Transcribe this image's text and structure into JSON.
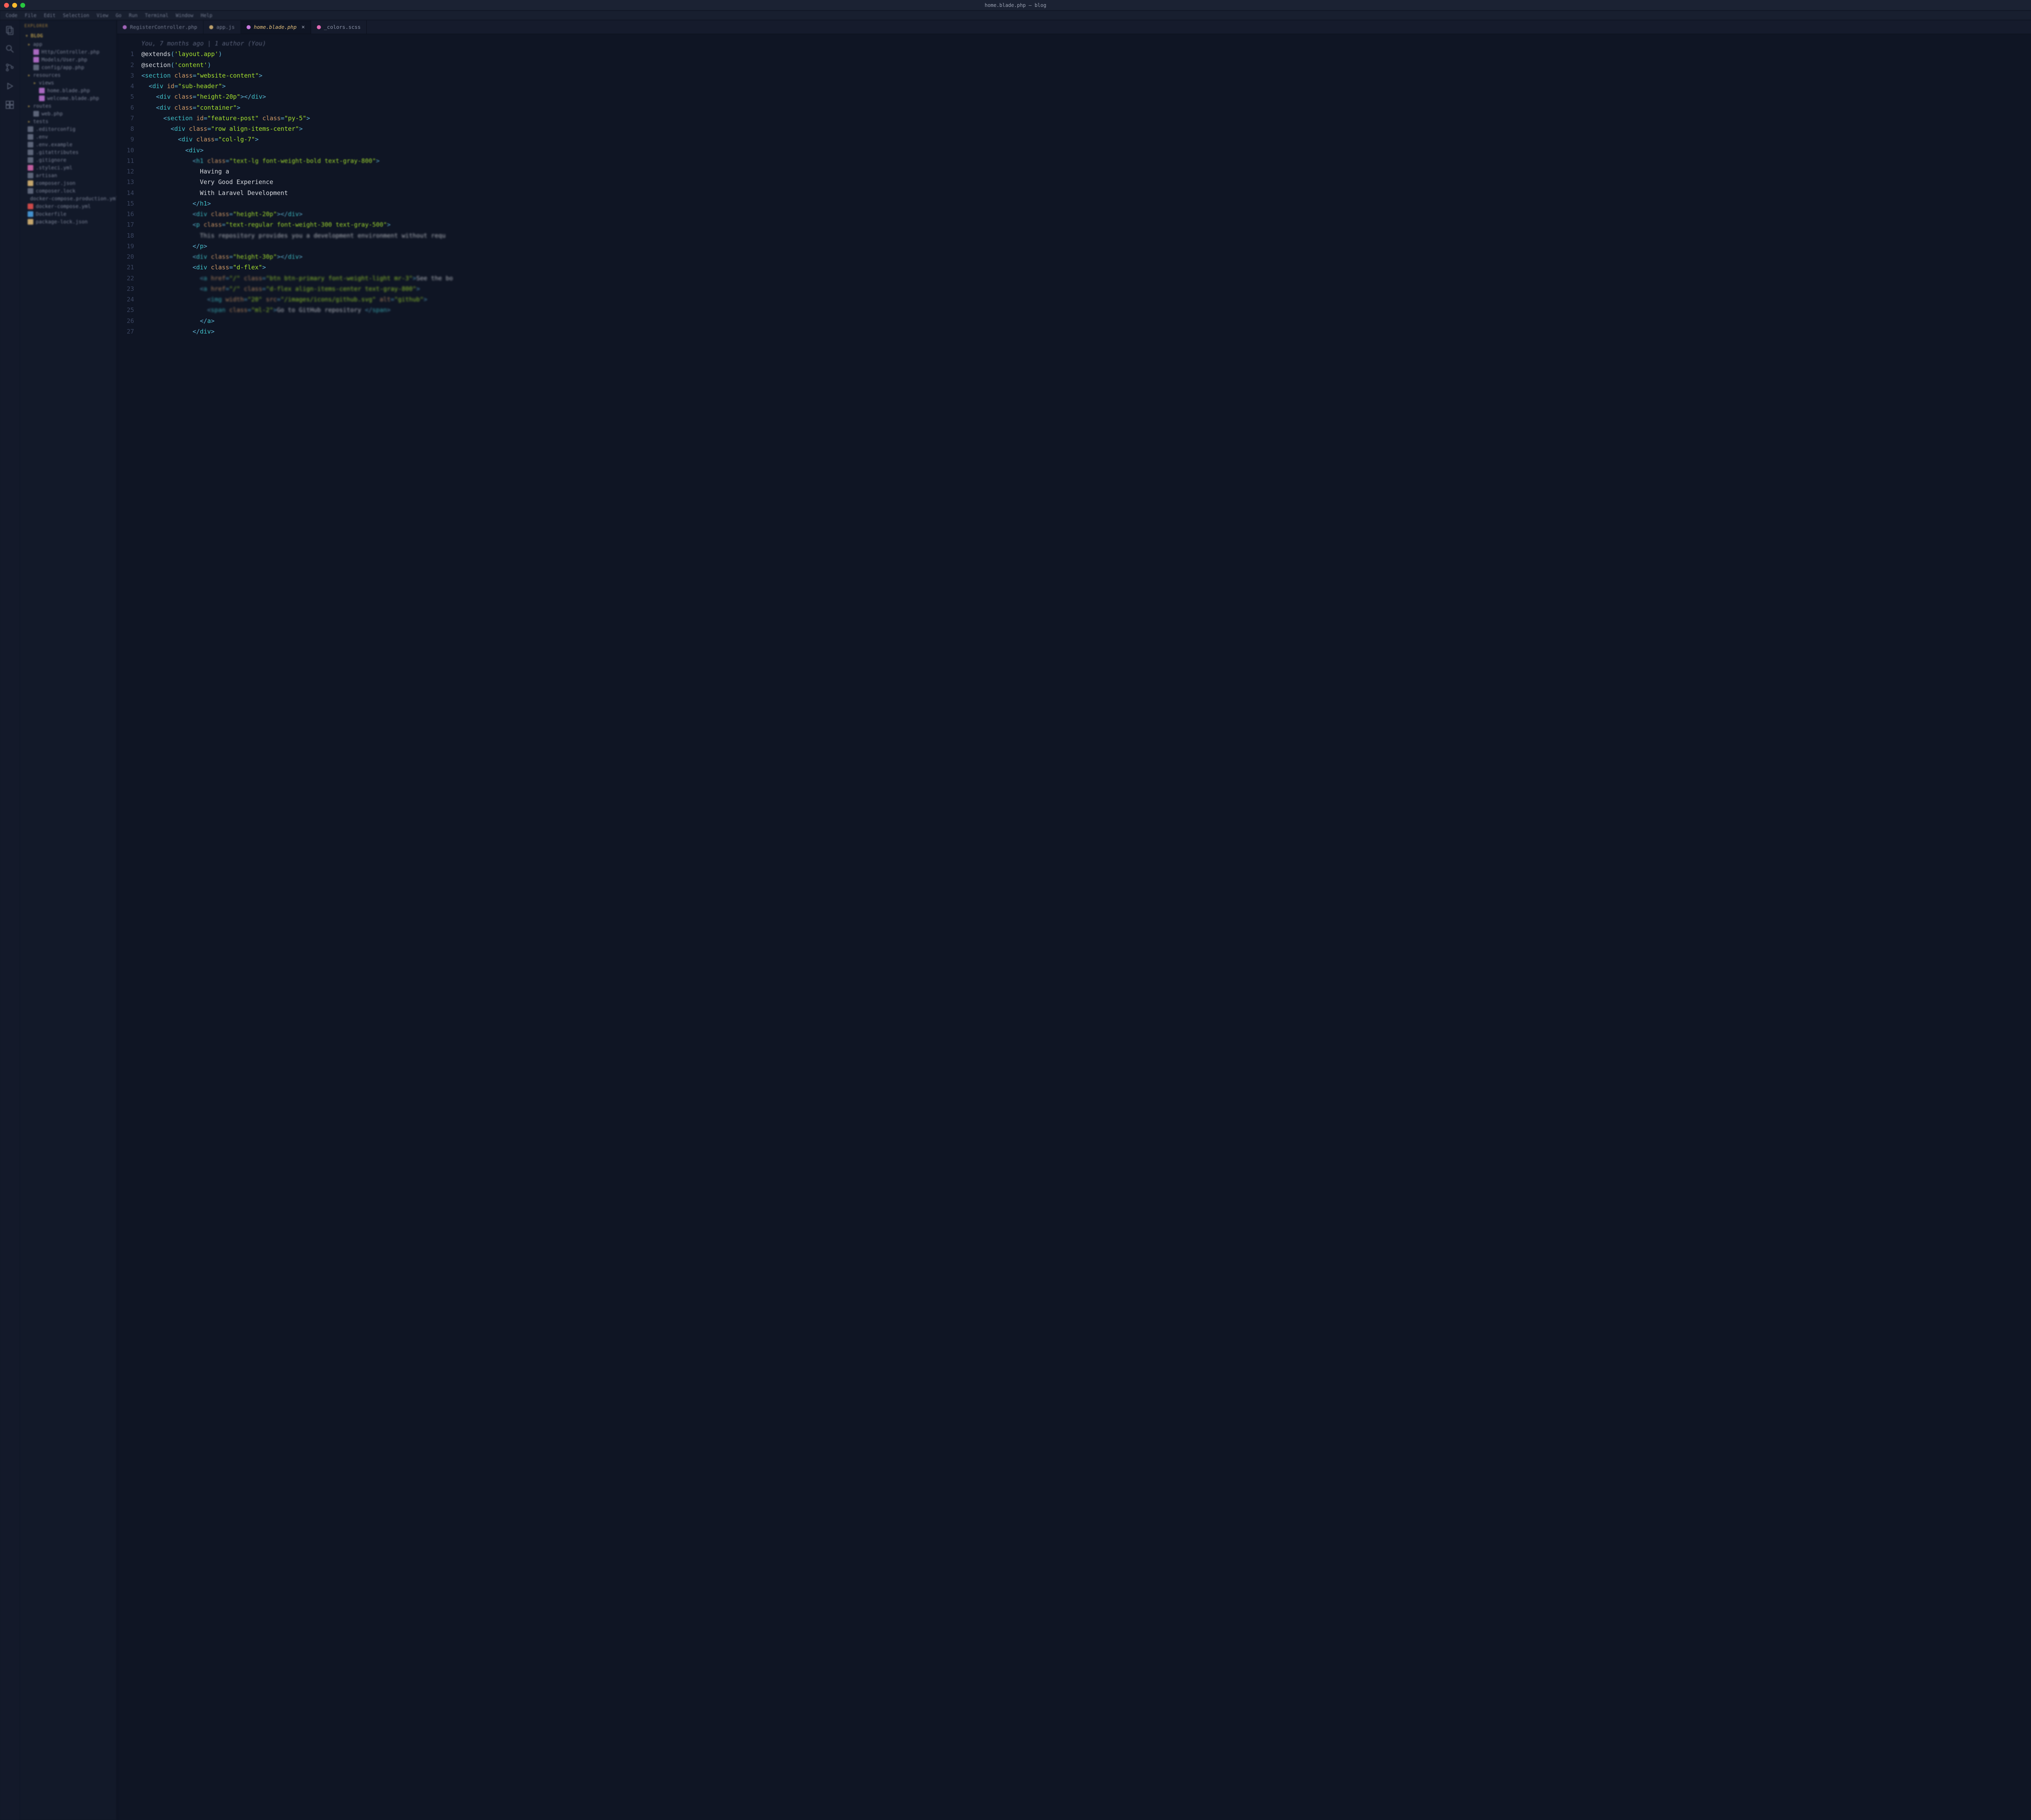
{
  "window": {
    "title": "home.blade.php — blog"
  },
  "menu": [
    "Code",
    "File",
    "Edit",
    "Selection",
    "View",
    "Go",
    "Run",
    "Terminal",
    "Window",
    "Help"
  ],
  "sidebar": {
    "header": "EXPLORER",
    "project": "BLOG",
    "items": [
      {
        "depth": 1,
        "icon": "dir",
        "label": "app",
        "kind": "dir"
      },
      {
        "depth": 2,
        "icon": "php",
        "label": "Http/Controller.php",
        "kind": "file"
      },
      {
        "depth": 2,
        "icon": "php",
        "label": "Models/User.php",
        "kind": "file"
      },
      {
        "depth": 2,
        "icon": "gray",
        "label": "config/app.php",
        "kind": "file"
      },
      {
        "depth": 1,
        "icon": "dir",
        "label": "resources",
        "kind": "dir"
      },
      {
        "depth": 2,
        "icon": "dir",
        "label": "views",
        "kind": "dir"
      },
      {
        "depth": 3,
        "icon": "php",
        "label": "home.blade.php",
        "kind": "file"
      },
      {
        "depth": 3,
        "icon": "php",
        "label": "welcome.blade.php",
        "kind": "file"
      },
      {
        "depth": 1,
        "icon": "dir",
        "label": "routes",
        "kind": "dir"
      },
      {
        "depth": 2,
        "icon": "gray",
        "label": "web.php",
        "kind": "file"
      },
      {
        "depth": 1,
        "icon": "dir",
        "label": "tests",
        "kind": "dir"
      },
      {
        "depth": 1,
        "icon": "gray",
        "label": ".editorconfig",
        "kind": "file"
      },
      {
        "depth": 1,
        "icon": "gray",
        "label": ".env",
        "kind": "file"
      },
      {
        "depth": 1,
        "icon": "gray",
        "label": ".env.example",
        "kind": "file"
      },
      {
        "depth": 1,
        "icon": "gray",
        "label": ".gitattributes",
        "kind": "file"
      },
      {
        "depth": 1,
        "icon": "gray",
        "label": ".gitignore",
        "kind": "file"
      },
      {
        "depth": 1,
        "icon": "pink",
        "label": ".styleci.yml",
        "kind": "file"
      },
      {
        "depth": 1,
        "icon": "gray",
        "label": "artisan",
        "kind": "file"
      },
      {
        "depth": 1,
        "icon": "json",
        "label": "composer.json",
        "kind": "file"
      },
      {
        "depth": 1,
        "icon": "gray",
        "label": "composer.lock",
        "kind": "file"
      },
      {
        "depth": 1,
        "icon": "yml",
        "label": "docker-compose.production.yml",
        "kind": "file"
      },
      {
        "depth": 1,
        "icon": "yml",
        "label": "docker-compose.yml",
        "kind": "file"
      },
      {
        "depth": 1,
        "icon": "blue",
        "label": "Dockerfile",
        "kind": "file"
      },
      {
        "depth": 1,
        "icon": "json",
        "label": "package-lock.json",
        "kind": "file"
      }
    ]
  },
  "tabs": [
    {
      "icon": "#c678dd",
      "label": "RegisterController.php",
      "active": false,
      "blur": true
    },
    {
      "icon": "#e5c07b",
      "label": "app.js",
      "active": false,
      "blur": true
    },
    {
      "icon": "#c678dd",
      "label": "home.blade.php",
      "active": true,
      "close": true
    },
    {
      "icon": "#e06ab4",
      "label": "_colors.scss",
      "active": false
    }
  ],
  "editor": {
    "blame": "You, 7 months ago | 1 author (You)",
    "lines": [
      {
        "n": 1,
        "tokens": [
          [
            "dir",
            "@extends"
          ],
          [
            "br",
            "("
          ],
          [
            "str",
            "'layout.app'"
          ],
          [
            "br",
            ")"
          ]
        ]
      },
      {
        "n": 2,
        "tokens": [
          [
            "dir",
            "@section"
          ],
          [
            "br",
            "("
          ],
          [
            "str",
            "'content'"
          ],
          [
            "br",
            ")"
          ]
        ]
      },
      {
        "n": 3,
        "indent": 0,
        "tokens": [
          [
            "br",
            "<"
          ],
          [
            "tag",
            "section "
          ],
          [
            "attr",
            "class"
          ],
          [
            "eq",
            "="
          ],
          [
            "str",
            "\"website-content\""
          ],
          [
            "br",
            ">"
          ]
        ]
      },
      {
        "n": 4,
        "indent": 1,
        "tokens": [
          [
            "br",
            "<"
          ],
          [
            "tag",
            "div "
          ],
          [
            "attr",
            "id"
          ],
          [
            "eq",
            "="
          ],
          [
            "str",
            "\"sub-header\""
          ],
          [
            "br",
            ">"
          ]
        ]
      },
      {
        "n": 5,
        "indent": 2,
        "tokens": [
          [
            "br",
            "<"
          ],
          [
            "tag",
            "div "
          ],
          [
            "attr",
            "class"
          ],
          [
            "eq",
            "="
          ],
          [
            "str",
            "\"height-20p\""
          ],
          [
            "br",
            ">"
          ],
          [
            "br",
            "</"
          ],
          [
            "tag",
            "div"
          ],
          [
            "br",
            ">"
          ]
        ]
      },
      {
        "n": 6,
        "indent": 2,
        "tokens": [
          [
            "br",
            "<"
          ],
          [
            "tag",
            "div "
          ],
          [
            "attr",
            "class"
          ],
          [
            "eq",
            "="
          ],
          [
            "str",
            "\"container\""
          ],
          [
            "br",
            ">"
          ]
        ]
      },
      {
        "n": 7,
        "indent": 3,
        "tokens": [
          [
            "br",
            "<"
          ],
          [
            "tag",
            "section "
          ],
          [
            "attr",
            "id"
          ],
          [
            "eq",
            "="
          ],
          [
            "str",
            "\"feature-post\""
          ],
          [
            "txt",
            " "
          ],
          [
            "attr",
            "class"
          ],
          [
            "eq",
            "="
          ],
          [
            "str",
            "\"py-5\""
          ],
          [
            "br",
            ">"
          ]
        ]
      },
      {
        "n": 8,
        "indent": 4,
        "tokens": [
          [
            "br",
            "<"
          ],
          [
            "tag",
            "div "
          ],
          [
            "attr",
            "class"
          ],
          [
            "eq",
            "="
          ],
          [
            "str",
            "\"row align-items-center\""
          ],
          [
            "br",
            ">"
          ]
        ]
      },
      {
        "n": 9,
        "indent": 5,
        "tokens": [
          [
            "br",
            "<"
          ],
          [
            "tag",
            "div "
          ],
          [
            "attr",
            "class"
          ],
          [
            "eq",
            "="
          ],
          [
            "str",
            "\"col-lg-7\""
          ],
          [
            "br",
            ">"
          ]
        ]
      },
      {
        "n": 10,
        "indent": 6,
        "tokens": [
          [
            "br",
            "<"
          ],
          [
            "tag",
            "div"
          ],
          [
            "br",
            ">"
          ]
        ]
      },
      {
        "n": 11,
        "indent": 7,
        "blur": "r",
        "tokens": [
          [
            "br",
            "<"
          ],
          [
            "tag",
            "h1 "
          ],
          [
            "attr",
            "class"
          ],
          [
            "eq",
            "="
          ],
          [
            "str",
            "\"text-lg font-weight-bold text-gray-800\""
          ],
          [
            "br",
            ">"
          ]
        ]
      },
      {
        "n": 12,
        "indent": 8,
        "tokens": [
          [
            "txt",
            "Having a"
          ]
        ]
      },
      {
        "n": 13,
        "indent": 8,
        "tokens": [
          [
            "txt",
            "Very Good Experience"
          ]
        ]
      },
      {
        "n": 14,
        "indent": 8,
        "tokens": [
          [
            "txt",
            "With Laravel Development"
          ]
        ]
      },
      {
        "n": 15,
        "indent": 7,
        "tokens": [
          [
            "br",
            "</"
          ],
          [
            "tag",
            "h1"
          ],
          [
            "br",
            ">"
          ]
        ]
      },
      {
        "n": 16,
        "indent": 7,
        "blur": "r",
        "tokens": [
          [
            "br",
            "<"
          ],
          [
            "tag",
            "div "
          ],
          [
            "attr",
            "class"
          ],
          [
            "eq",
            "="
          ],
          [
            "str",
            "\"height-20p\""
          ],
          [
            "br",
            ">"
          ],
          [
            "br",
            "</"
          ],
          [
            "tag",
            "div"
          ],
          [
            "br",
            ">"
          ]
        ]
      },
      {
        "n": 17,
        "indent": 7,
        "blur": "r",
        "tokens": [
          [
            "br",
            "<"
          ],
          [
            "tag",
            "p "
          ],
          [
            "attr",
            "class"
          ],
          [
            "eq",
            "="
          ],
          [
            "str",
            "\"text-regular font-weight-300 text-gray-500\""
          ],
          [
            "br",
            ">"
          ]
        ]
      },
      {
        "n": 18,
        "indent": 8,
        "blur": "rr",
        "tokens": [
          [
            "txt",
            "This repository provides you a development environment without requ"
          ]
        ]
      },
      {
        "n": 19,
        "indent": 7,
        "tokens": [
          [
            "br",
            "</"
          ],
          [
            "tag",
            "p"
          ],
          [
            "br",
            ">"
          ]
        ]
      },
      {
        "n": 20,
        "indent": 7,
        "blur": "r",
        "tokens": [
          [
            "br",
            "<"
          ],
          [
            "tag",
            "div "
          ],
          [
            "attr",
            "class"
          ],
          [
            "eq",
            "="
          ],
          [
            "str",
            "\"height-30p\""
          ],
          [
            "br",
            ">"
          ],
          [
            "br",
            "</"
          ],
          [
            "tag",
            "div"
          ],
          [
            "br",
            ">"
          ]
        ]
      },
      {
        "n": 21,
        "indent": 7,
        "tokens": [
          [
            "br",
            "<"
          ],
          [
            "tag",
            "div "
          ],
          [
            "attr",
            "class"
          ],
          [
            "eq",
            "="
          ],
          [
            "str",
            "\"d-flex\""
          ],
          [
            "br",
            ">"
          ]
        ]
      },
      {
        "n": 22,
        "indent": 8,
        "blur": "rr",
        "tokens": [
          [
            "br",
            "<"
          ],
          [
            "tag",
            "a "
          ],
          [
            "attr",
            "href"
          ],
          [
            "eq",
            "="
          ],
          [
            "str",
            "\"/\""
          ],
          [
            "txt",
            " "
          ],
          [
            "attr",
            "class"
          ],
          [
            "eq",
            "="
          ],
          [
            "str",
            "\"btn btn-primary font-weight-light mr-3\""
          ],
          [
            "br",
            ">"
          ],
          [
            "txt",
            "See the bo"
          ]
        ]
      },
      {
        "n": 23,
        "indent": 8,
        "blur": "rr",
        "tokens": [
          [
            "br",
            "<"
          ],
          [
            "tag",
            "a "
          ],
          [
            "attr",
            "href"
          ],
          [
            "eq",
            "="
          ],
          [
            "str",
            "\"/\""
          ],
          [
            "txt",
            " "
          ],
          [
            "attr",
            "class"
          ],
          [
            "eq",
            "="
          ],
          [
            "str",
            "\"d-flex align-items-center text-gray-800\""
          ],
          [
            "br",
            ">"
          ]
        ]
      },
      {
        "n": 24,
        "indent": 9,
        "blur": "rr",
        "tokens": [
          [
            "br",
            "<"
          ],
          [
            "tag",
            "img "
          ],
          [
            "attr",
            "width"
          ],
          [
            "eq",
            "="
          ],
          [
            "str",
            "\"20\""
          ],
          [
            "txt",
            " "
          ],
          [
            "attr",
            "src"
          ],
          [
            "eq",
            "="
          ],
          [
            "str",
            "\"/images/icons/github.svg\""
          ],
          [
            "txt",
            " "
          ],
          [
            "attr",
            "alt"
          ],
          [
            "eq",
            "="
          ],
          [
            "str",
            "\"github\""
          ],
          [
            "br",
            ">"
          ]
        ]
      },
      {
        "n": 25,
        "indent": 9,
        "blur": "rr",
        "tokens": [
          [
            "br",
            "<"
          ],
          [
            "tag",
            "span "
          ],
          [
            "attr",
            "class"
          ],
          [
            "eq",
            "="
          ],
          [
            "str",
            "\"ml-2\""
          ],
          [
            "br",
            ">"
          ],
          [
            "txt",
            "Go to GitHub repository "
          ],
          [
            "br",
            "</"
          ],
          [
            "tag",
            "span"
          ],
          [
            "br",
            ">"
          ]
        ]
      },
      {
        "n": 26,
        "indent": 8,
        "tokens": [
          [
            "br",
            "</"
          ],
          [
            "tag",
            "a"
          ],
          [
            "br",
            ">"
          ]
        ]
      },
      {
        "n": 27,
        "indent": 7,
        "tokens": [
          [
            "br",
            "</"
          ],
          [
            "tag",
            "div"
          ],
          [
            "br",
            ">"
          ]
        ]
      }
    ]
  }
}
